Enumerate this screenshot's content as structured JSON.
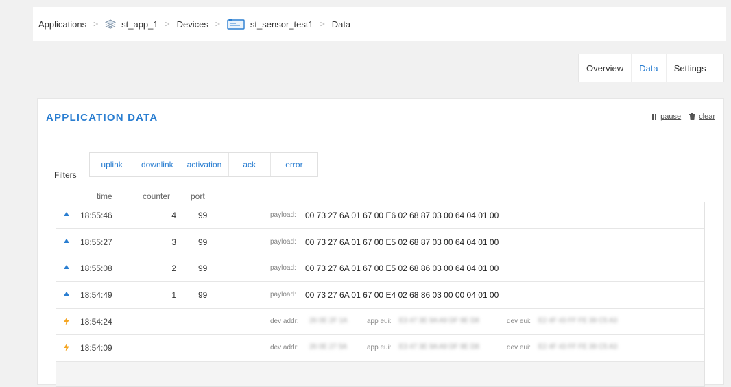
{
  "breadcrumb": {
    "applications": "Applications",
    "app": "st_app_1",
    "devices": "Devices",
    "device": "st_sensor_test1",
    "current": "Data",
    "separator": ">"
  },
  "tabs": [
    {
      "label": "Overview",
      "active": false
    },
    {
      "label": "Data",
      "active": true
    },
    {
      "label": "Settings",
      "active": false
    }
  ],
  "card": {
    "title": "APPLICATION DATA",
    "pause_label": "pause",
    "clear_label": "clear"
  },
  "filters": {
    "label": "Filters",
    "items": [
      "uplink",
      "downlink",
      "activation",
      "ack",
      "error"
    ]
  },
  "columns": {
    "time": "time",
    "counter": "counter",
    "port": "port"
  },
  "rows": [
    {
      "type": "uplink",
      "time": "18:55:46",
      "counter": "4",
      "port": "99",
      "payload_label": "payload:",
      "payload": "00 73 27 6A 01 67 00 E6 02 68 87 03 00 64 04 01 00"
    },
    {
      "type": "uplink",
      "time": "18:55:27",
      "counter": "3",
      "port": "99",
      "payload_label": "payload:",
      "payload": "00 73 27 6A 01 67 00 E5 02 68 87 03 00 64 04 01 00"
    },
    {
      "type": "uplink",
      "time": "18:55:08",
      "counter": "2",
      "port": "99",
      "payload_label": "payload:",
      "payload": "00 73 27 6A 01 67 00 E5 02 68 86 03 00 64 04 01 00"
    },
    {
      "type": "uplink",
      "time": "18:54:49",
      "counter": "1",
      "port": "99",
      "payload_label": "payload:",
      "payload": "00 73 27 6A 01 67 00 E4 02 68 86 03 00 00 04 01 00"
    },
    {
      "type": "activation",
      "time": "18:54:24",
      "dev_addr_label": "dev addr:",
      "dev_addr": "26 0E 2F 1A",
      "app_eui_label": "app eui:",
      "app_eui": "E3 47 3E 9A A9 DF 9E D8",
      "dev_eui_label": "dev eui:",
      "dev_eui": "E2 4F 43 FF FE 39 C5 A3"
    },
    {
      "type": "activation",
      "time": "18:54:09",
      "dev_addr_label": "dev addr:",
      "dev_addr": "26 0E 27 5A",
      "app_eui_label": "app eui:",
      "app_eui": "E3 47 3E 9A A9 DF 9E D8",
      "dev_eui_label": "dev eui:",
      "dev_eui": "E2 4F 43 FF FE 39 C5 A3"
    }
  ],
  "colors": {
    "accent": "#2a7ed1",
    "activation": "#f5a623"
  }
}
